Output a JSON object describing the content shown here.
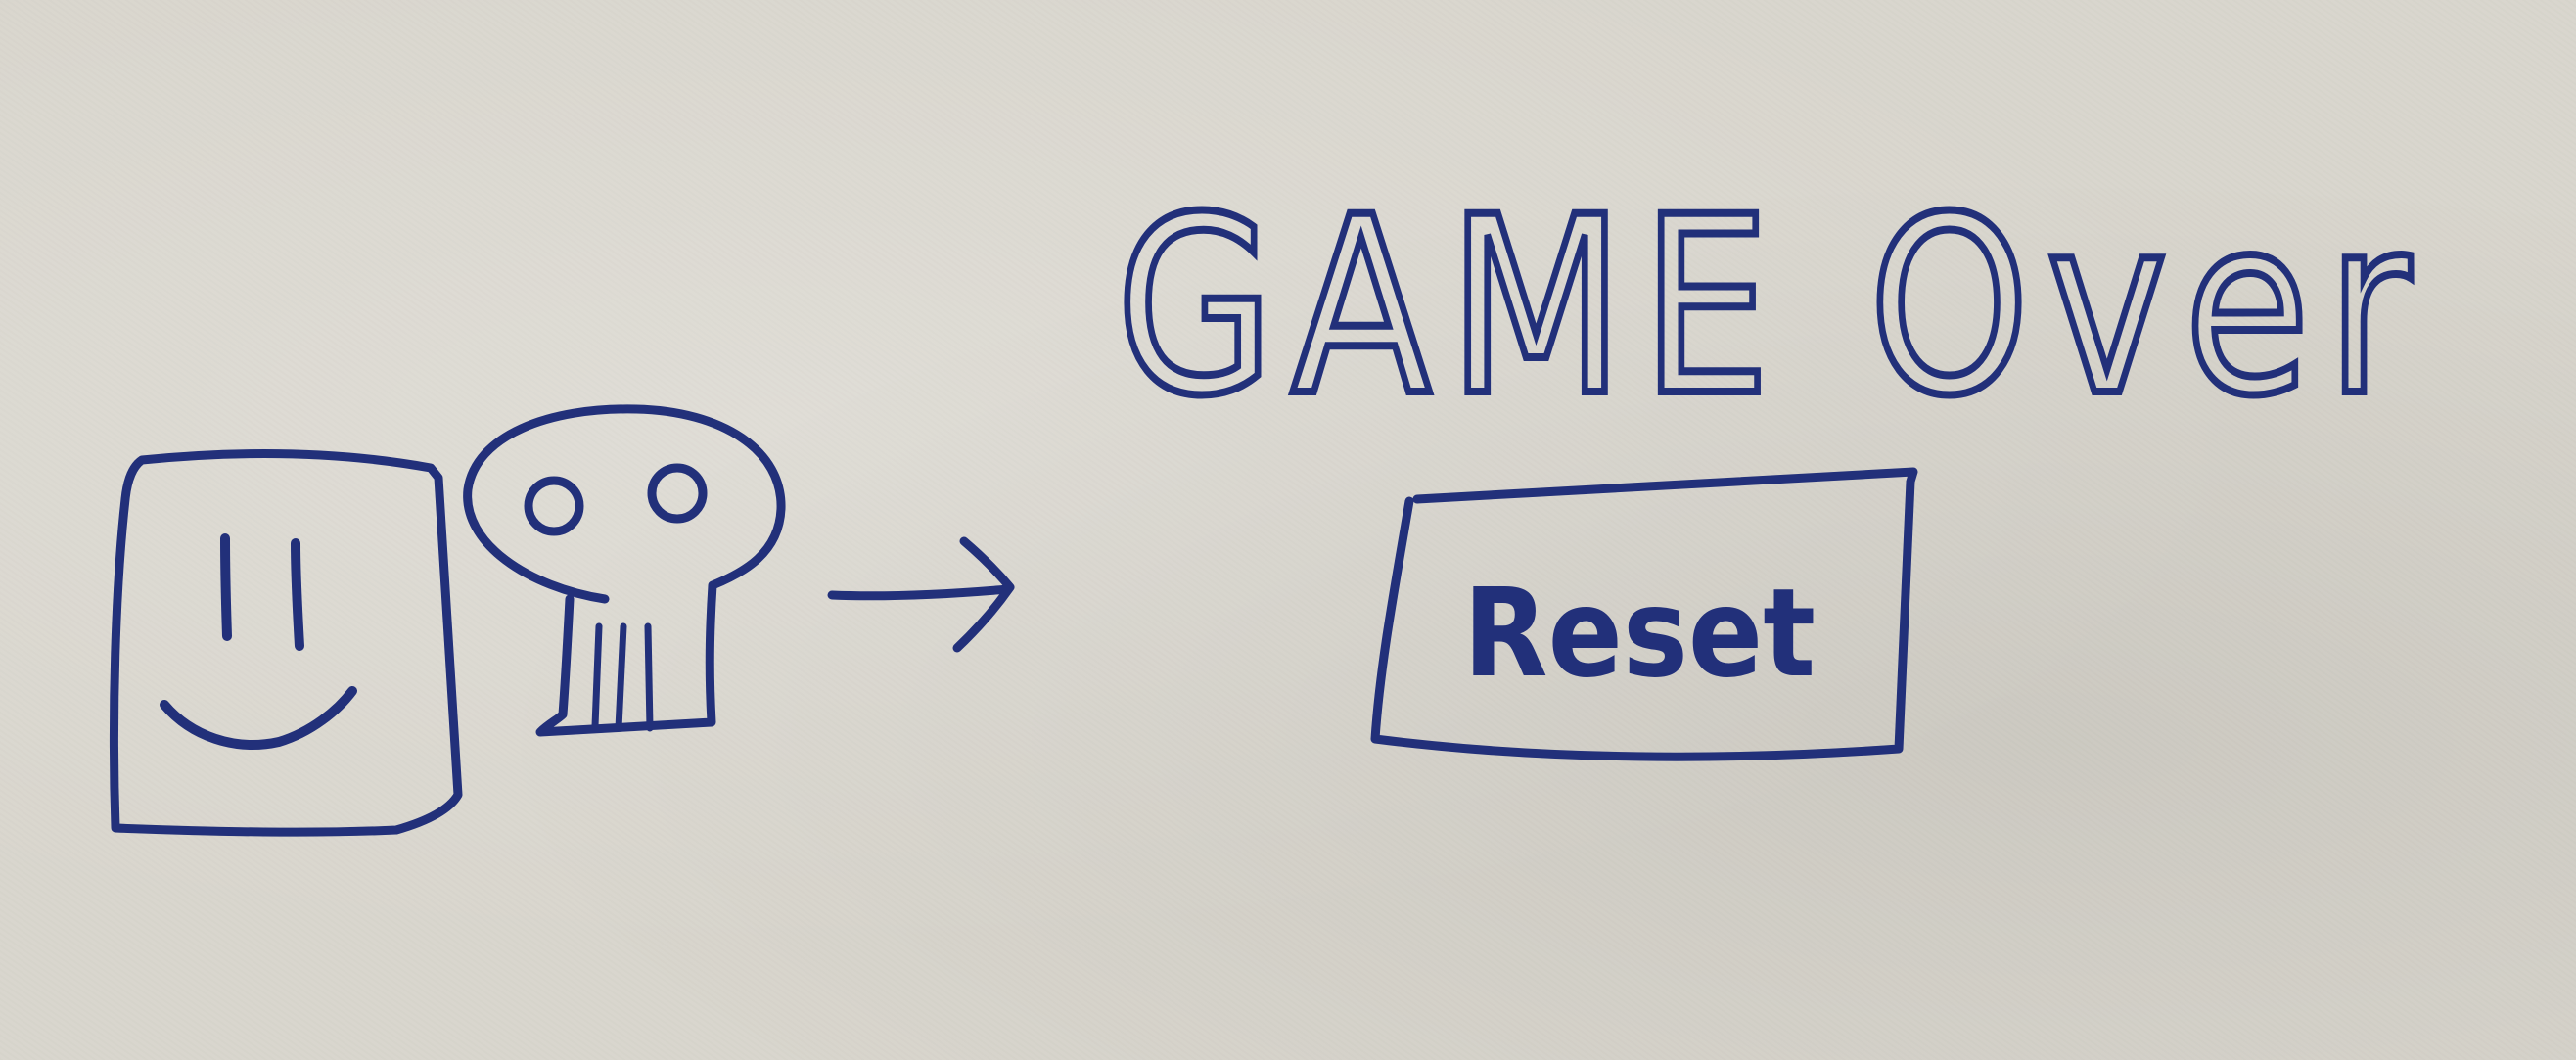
{
  "title": "GAME Over",
  "button": {
    "label": "Reset"
  },
  "colors": {
    "paper": "#d9d6cd",
    "ink": "#22307a"
  },
  "icons": {
    "player": "smiley-face-icon",
    "death": "skull-icon",
    "transition": "arrow-right-icon"
  }
}
